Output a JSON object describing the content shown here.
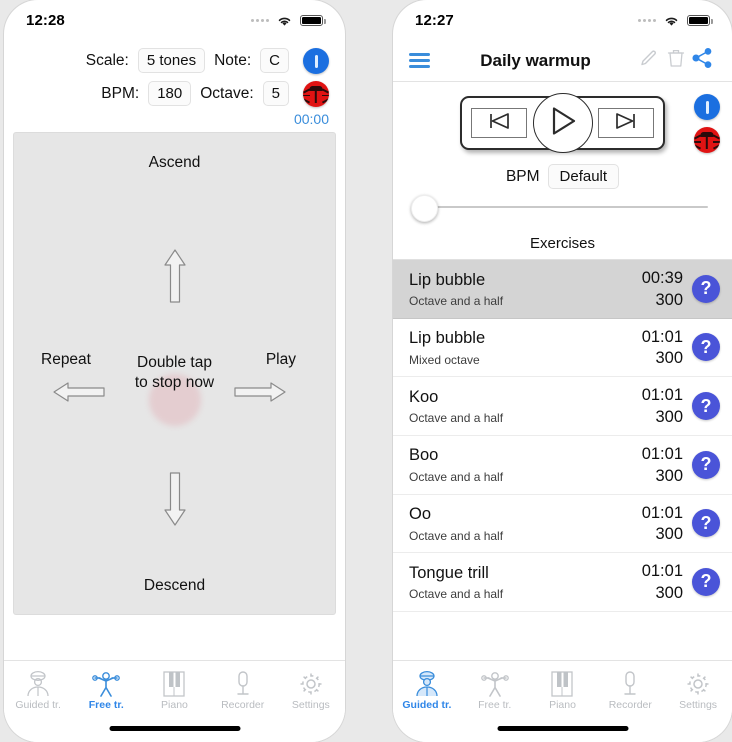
{
  "left_phone": {
    "status_bar": {
      "time": "12:28",
      "wifi_icon": "wifi-icon",
      "battery_icon": "battery-icon",
      "signal_icon": "signal-dots-icon"
    },
    "controls": {
      "scale_label": "Scale:",
      "scale_value": "5 tones",
      "note_label": "Note:",
      "note_value": "C",
      "bpm_label": "BPM:",
      "bpm_value": "180",
      "octave_label": "Octave:",
      "octave_value": "5",
      "info_icon": "info-icon",
      "bug_icon": "ladybug-icon"
    },
    "timer": "00:00",
    "training_area": {
      "ascend_label": "Ascend",
      "descend_label": "Descend",
      "repeat_label": "Repeat",
      "play_label": "Play",
      "center_line1": "Double tap",
      "center_line2": "to stop now",
      "arrow_up_icon": "arrow-up-icon",
      "arrow_down_icon": "arrow-down-icon",
      "arrow_left_icon": "arrow-left-icon",
      "arrow_right_icon": "arrow-right-icon"
    },
    "tabs": [
      {
        "label": "Guided tr.",
        "icon": "teacher-icon",
        "active": false
      },
      {
        "label": "Free tr.",
        "icon": "exercise-person-icon",
        "active": true
      },
      {
        "label": "Piano",
        "icon": "piano-keys-icon",
        "active": false
      },
      {
        "label": "Recorder",
        "icon": "microphone-icon",
        "active": false
      },
      {
        "label": "Settings",
        "icon": "gear-icon",
        "active": false
      }
    ]
  },
  "right_phone": {
    "status_bar": {
      "time": "12:27",
      "wifi_icon": "wifi-icon",
      "battery_icon": "battery-icon",
      "signal_icon": "signal-dots-icon"
    },
    "navbar": {
      "menu_icon": "hamburger-menu-icon",
      "title": "Daily warmup",
      "edit_icon": "pencil-edit-icon",
      "delete_icon": "trash-icon",
      "share_icon": "share-icon"
    },
    "player": {
      "previous_icon": "skip-previous-icon",
      "play_icon": "play-icon",
      "next_icon": "skip-next-icon",
      "info_icon": "info-icon",
      "bug_icon": "ladybug-icon"
    },
    "bpm": {
      "label": "BPM",
      "value": "Default"
    },
    "slider": {
      "name": "volume-slider",
      "position_percent": 0
    },
    "section_title": "Exercises",
    "exercises": [
      {
        "name": "Lip bubble",
        "subtitle": "Octave and a half",
        "time": "00:39",
        "count": "300",
        "help_icon": "help-icon",
        "selected": true
      },
      {
        "name": "Lip bubble",
        "subtitle": "Mixed octave",
        "time": "01:01",
        "count": "300",
        "help_icon": "help-icon",
        "selected": false
      },
      {
        "name": "Koo",
        "subtitle": "Octave and a half",
        "time": "01:01",
        "count": "300",
        "help_icon": "help-icon",
        "selected": false
      },
      {
        "name": "Boo",
        "subtitle": "Octave and a half",
        "time": "01:01",
        "count": "300",
        "help_icon": "help-icon",
        "selected": false
      },
      {
        "name": "Oo",
        "subtitle": "Octave and a half",
        "time": "01:01",
        "count": "300",
        "help_icon": "help-icon",
        "selected": false
      },
      {
        "name": "Tongue trill",
        "subtitle": "Octave and a half",
        "time": "01:01",
        "count": "300",
        "help_icon": "help-icon",
        "selected": false
      }
    ],
    "tabs": [
      {
        "label": "Guided tr.",
        "icon": "teacher-icon",
        "active": true
      },
      {
        "label": "Free tr.",
        "icon": "exercise-person-icon",
        "active": false
      },
      {
        "label": "Piano",
        "icon": "piano-keys-icon",
        "active": false
      },
      {
        "label": "Recorder",
        "icon": "microphone-icon",
        "active": false
      },
      {
        "label": "Settings",
        "icon": "gear-icon",
        "active": false
      }
    ]
  },
  "colors": {
    "accent_blue": "#2f86e8",
    "info_blue": "#1b6fe0",
    "bug_red": "#e01313",
    "help_purple": "#4a54d8",
    "ascend_red": "#e8453c",
    "timer_blue": "#3a8ddb",
    "panel_grey": "#e6e6e6",
    "row_selected_grey": "#d4d4d4"
  }
}
